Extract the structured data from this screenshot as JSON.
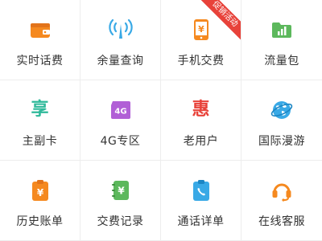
{
  "colors": {
    "orange": "#f5891f",
    "blue": "#39a9e6",
    "teal": "#2fb99a",
    "green": "#5cb85c",
    "purple": "#b15fd6",
    "red": "#e8423a",
    "ribbon": "#e8423a"
  },
  "items": [
    {
      "label": "实时话费",
      "icon": "wallet-icon"
    },
    {
      "label": "余量查询",
      "icon": "signal-waves-icon"
    },
    {
      "label": "手机交费",
      "icon": "phone-yen-icon",
      "badge": "促销活动"
    },
    {
      "label": "流量包",
      "icon": "folder-bars-icon"
    },
    {
      "label": "主副卡",
      "icon": "xiang-glyph-icon",
      "glyph": "享"
    },
    {
      "label": "4G专区",
      "icon": "4g-badge-icon",
      "glyph": "4G"
    },
    {
      "label": "老用户",
      "icon": "hui-glyph-icon",
      "glyph": "惠"
    },
    {
      "label": "国际漫游",
      "icon": "globe-icon"
    },
    {
      "label": "历史账单",
      "icon": "clipboard-yen-icon"
    },
    {
      "label": "交费记录",
      "icon": "notebook-yen-icon"
    },
    {
      "label": "通话详单",
      "icon": "clipboard-phone-icon"
    },
    {
      "label": "在线客服",
      "icon": "headset-icon"
    }
  ]
}
